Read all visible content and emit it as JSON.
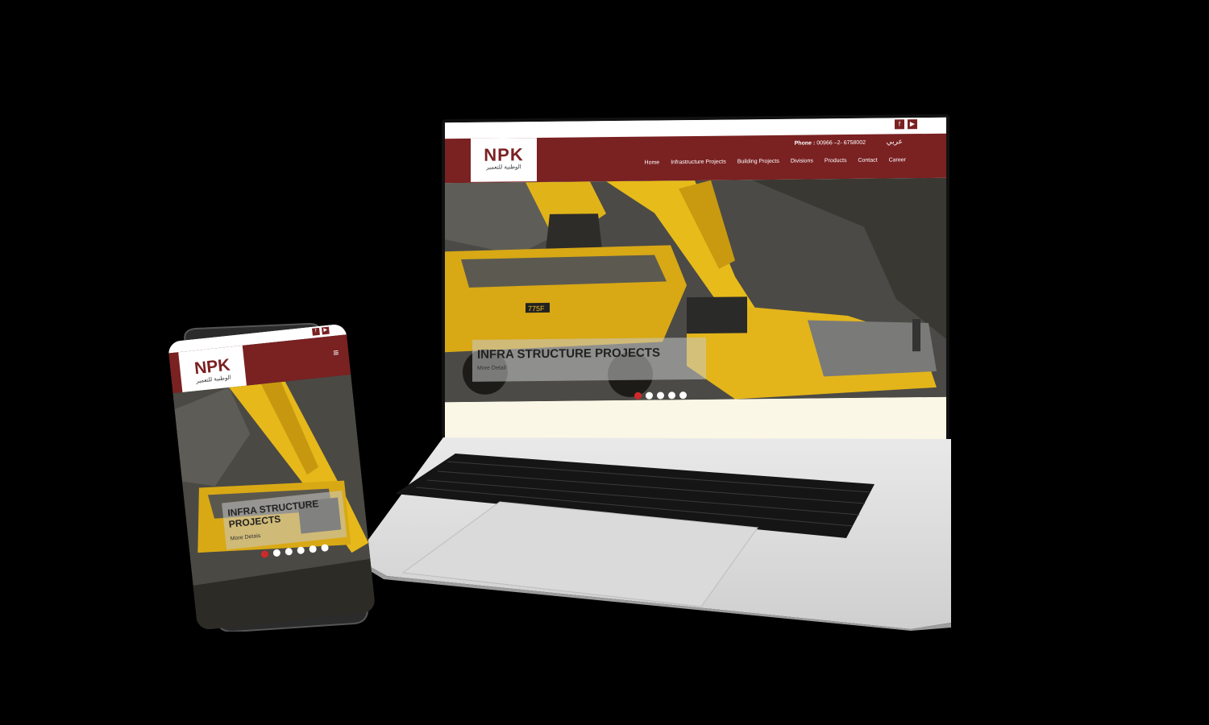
{
  "brand": {
    "name": "NPK",
    "tagline_ar": "الوطنية للتعمير",
    "accent": "#7a2122",
    "active_dot": "#d0292a"
  },
  "laptop": {
    "social": [
      {
        "icon": "facebook-icon",
        "glyph": "f"
      },
      {
        "icon": "youtube-icon",
        "glyph": "▶"
      }
    ],
    "phone_label": "Phone :",
    "phone_number": "00966 –2- 6758002",
    "lang_link": "عربي",
    "nav": [
      "Home",
      "Infrastructure Projects",
      "Building Projects",
      "Divisions",
      "Products",
      "Contact",
      "Career"
    ],
    "hero": {
      "title": "INFRA STRUCTURE PROJECTS",
      "link": "More Detail",
      "slides": 5,
      "active": 0
    }
  },
  "phone": {
    "social": [
      {
        "icon": "facebook-icon",
        "glyph": "f"
      },
      {
        "icon": "youtube-icon",
        "glyph": "▶"
      }
    ],
    "menu_glyph": "≡",
    "hero": {
      "title": "INFRA STRUCTURE PROJECTS",
      "link": "More Detais",
      "slides": 6,
      "active": 0
    }
  }
}
